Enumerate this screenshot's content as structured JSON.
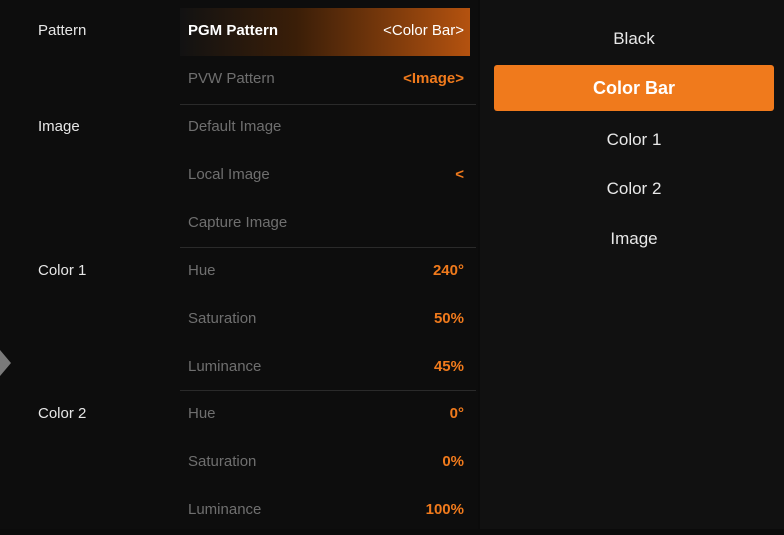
{
  "sections": {
    "pattern": {
      "label": "Pattern",
      "rows": [
        {
          "label": "PGM Pattern",
          "value": "<Color Bar>"
        },
        {
          "label": "PVW Pattern",
          "value": "<Image>"
        }
      ]
    },
    "image": {
      "label": "Image",
      "rows": [
        {
          "label": "Default Image",
          "value": ""
        },
        {
          "label": "Local Image",
          "value": "<"
        },
        {
          "label": "Capture Image",
          "value": ""
        }
      ]
    },
    "color1": {
      "label": "Color 1",
      "rows": [
        {
          "label": "Hue",
          "value": "240°"
        },
        {
          "label": "Saturation",
          "value": "50%"
        },
        {
          "label": "Luminance",
          "value": "45%"
        }
      ]
    },
    "color2": {
      "label": "Color 2",
      "rows": [
        {
          "label": "Hue",
          "value": "0°"
        },
        {
          "label": "Saturation",
          "value": "0%"
        },
        {
          "label": "Luminance",
          "value": "100%"
        }
      ]
    }
  },
  "options": {
    "items": [
      "Black",
      "Color Bar",
      "Color 1",
      "Color 2",
      "Image"
    ],
    "selected": "Color Bar"
  },
  "colors": {
    "accent": "#f07a1c",
    "background": "#0d0d0d",
    "label_dim": "#6f6f6f",
    "text": "#e6e6e6"
  },
  "icons": {
    "side_arrow": "chevron-right-icon"
  }
}
